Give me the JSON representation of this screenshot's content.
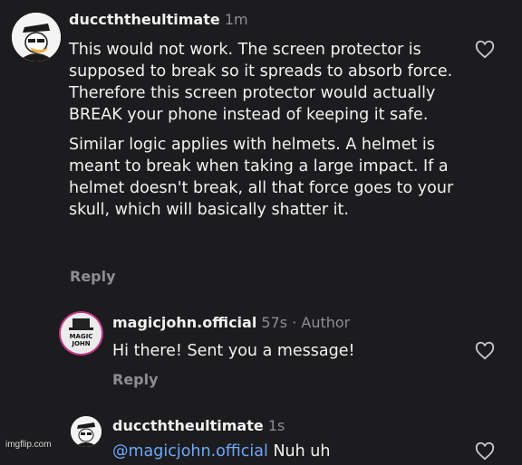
{
  "comments": [
    {
      "username": "duccththeultimate",
      "time": "1m",
      "paragraphs": [
        "This would not work. The screen protector is supposed to break so it spreads to absorb force. Therefore this screen protector would actually BREAK your phone instead of keeping it safe.",
        "Similar logic applies with helmets. A helmet is meant to break when taking a large impact. If a helmet doesn't break, all that force goes to your skull, which will basically shatter it."
      ],
      "reply_label": "Reply"
    },
    {
      "username": "magicjohn.official",
      "time": "57s",
      "badge": "Author",
      "text": "Hi there! Sent you a message!",
      "reply_label": "Reply",
      "avatar_text_1": "MAGIC",
      "avatar_text_2": "JOHN"
    },
    {
      "username": "duccththeultimate",
      "time": "1s",
      "mention": "@magicjohn.official",
      "text": "Nuh uh"
    }
  ],
  "watermark": "imgflip.com",
  "colors": {
    "background": "#1c1c1e",
    "text": "#f2f2f2",
    "muted": "#8e8e93",
    "mention": "#6ea8fe"
  }
}
